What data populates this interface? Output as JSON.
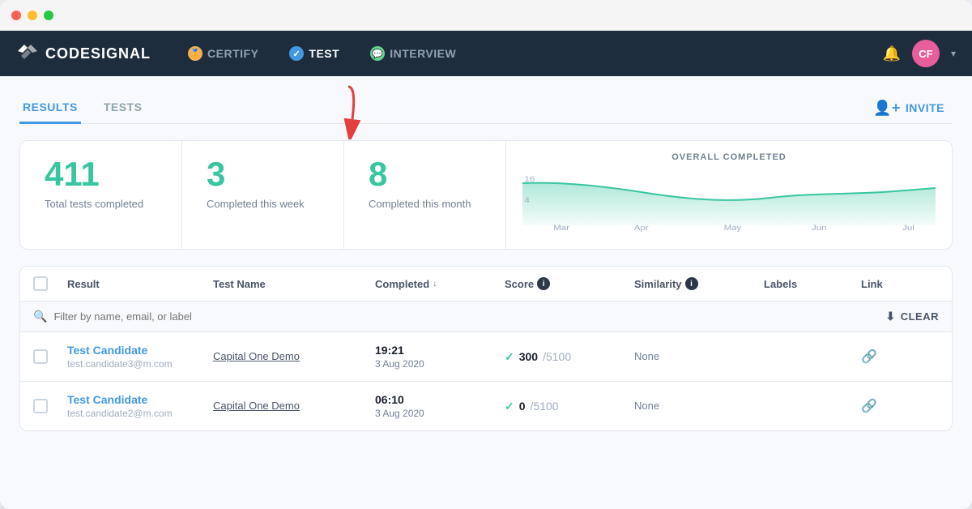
{
  "window": {
    "dots": [
      "red",
      "yellow",
      "green"
    ]
  },
  "navbar": {
    "logo": "CODESIGNAL",
    "items": [
      {
        "id": "certify",
        "label": "CERTIFY",
        "icon": "🏅",
        "active": false
      },
      {
        "id": "test",
        "label": "TEST",
        "icon": "✓",
        "active": true
      },
      {
        "id": "interview",
        "label": "INTERVIEW",
        "icon": "💬",
        "active": false
      }
    ],
    "avatar": "CF",
    "bell": "🔔"
  },
  "subnav": {
    "items": [
      {
        "id": "results",
        "label": "RESULTS",
        "active": true
      },
      {
        "id": "tests",
        "label": "TESTS",
        "active": false
      }
    ],
    "invite_label": "INVITE"
  },
  "stats": {
    "total": {
      "number": "411",
      "label": "Total tests completed"
    },
    "week": {
      "number": "3",
      "label": "Completed this week"
    },
    "month": {
      "number": "8",
      "label": "Completed this month"
    },
    "chart": {
      "title": "OVERALL COMPLETED",
      "labels": [
        "Mar",
        "Apr",
        "May",
        "Jun",
        "Jul"
      ],
      "y_values": [
        "16",
        "4"
      ]
    }
  },
  "table": {
    "headers": [
      "Result",
      "Test Name",
      "Completed",
      "Score",
      "Similarity",
      "Labels",
      "Link"
    ],
    "filter_placeholder": "Filter by name, email, or label",
    "clear_label": "CLEAR",
    "rows": [
      {
        "name": "Test Candidate",
        "email": "test.candidate3@m.com",
        "test_name": "Capital One Demo",
        "time": "19:21",
        "date": "3 Aug 2020",
        "score": "300",
        "total": "5100",
        "similarity": "None",
        "labels": ""
      },
      {
        "name": "Test Candidate",
        "email": "test.candidate2@m.com",
        "test_name": "Capital One Demo",
        "time": "06:10",
        "date": "3 Aug 2020",
        "score": "0",
        "total": "5100",
        "similarity": "None",
        "labels": ""
      }
    ]
  }
}
